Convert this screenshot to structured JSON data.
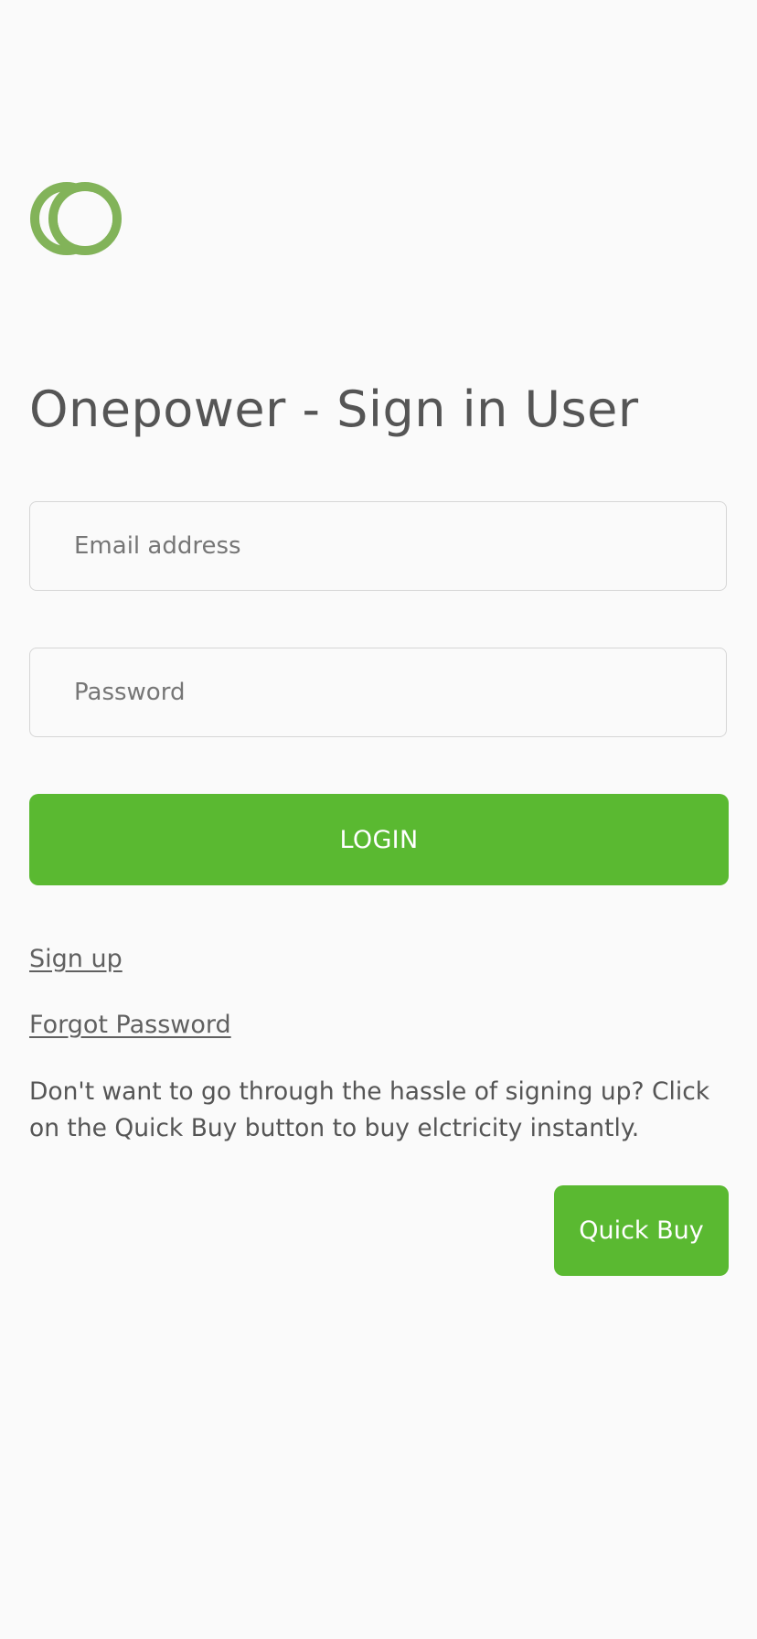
{
  "logo": {
    "icon": "double-ring-logo",
    "color": "#82b359"
  },
  "title": "Onepower - Sign in User",
  "form": {
    "email_placeholder": "Email address",
    "password_placeholder": "Password",
    "login_label": "LOGIN"
  },
  "links": {
    "sign_up": "Sign up",
    "forgot_password": "Forgot Password"
  },
  "note": "Don't want to go through the hassle of signing up? Click on the Quick Buy button to buy elctricity instantly.",
  "quick_buy_label": "Quick Buy",
  "colors": {
    "accent": "#5ab931",
    "background": "#fafafa",
    "text": "#555555",
    "field_border": "#d6d6d6"
  }
}
